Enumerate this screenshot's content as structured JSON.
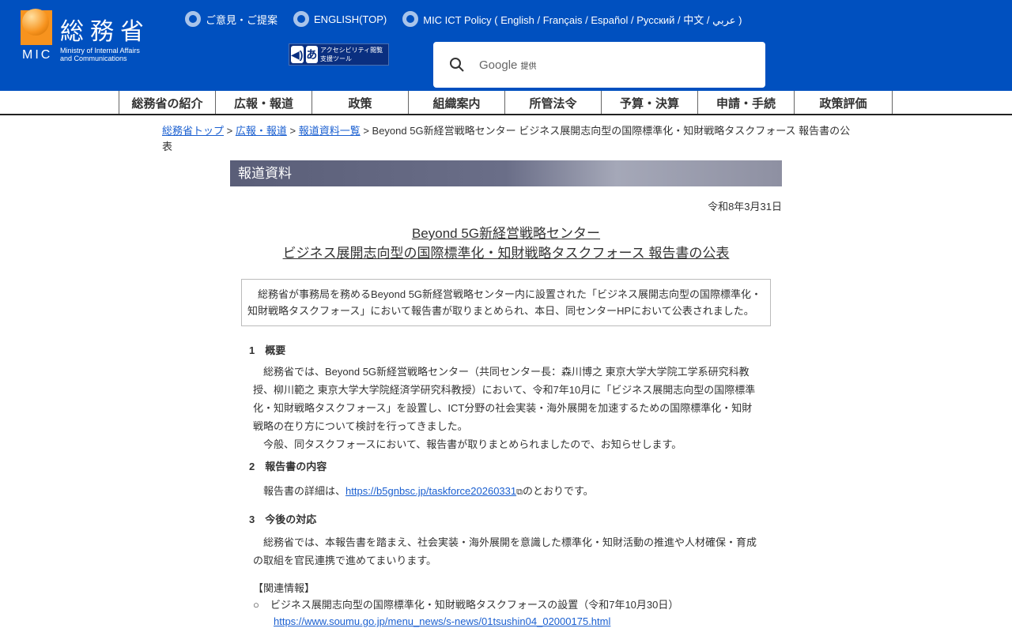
{
  "header": {
    "logo_jp": "総務省",
    "logo_mic": "MIC",
    "logo_en": [
      "Ministry of Internal Affairs",
      "and Communications"
    ],
    "links": [
      "ご意見・ご提案",
      "ENGLISH(TOP)",
      "MIC ICT Policy ( English / Français / Español / Русский / 中文 / عربي )"
    ],
    "a11y": "アクセシビリティ閲覧支援ツール",
    "search_brand": "Google",
    "search_provided": "提供"
  },
  "nav": [
    "総務省の紹介",
    "広報・報道",
    "政策",
    "組織案内",
    "所管法令",
    "予算・決算",
    "申請・手続",
    "政策評価"
  ],
  "breadcrumb": {
    "links": [
      "総務省トップ",
      "広報・報道",
      "報道資料一覧"
    ],
    "current": "Beyond 5G新経営戦略センター ビジネス展開志向型の国際標準化・知財戦略タスクフォース 報告書の公表"
  },
  "section_bar": "報道資料",
  "date": "令和8年3月31日",
  "title": [
    "Beyond 5G新経営戦略センター",
    "ビジネス展開志向型の国際標準化・知財戦略タスクフォース 報告書の公表"
  ],
  "summary": "総務省が事務局を務めるBeyond 5G新経営戦略センター内に設置された「ビジネス展開志向型の国際標準化・知財戦略タスクフォース」において報告書が取りまとめられ、本日、同センターHPにおいて公表されました。",
  "sections": [
    {
      "heading": "1　概要",
      "body": [
        "総務省では、Beyond 5G新経営戦略センター（共同センター長：森川博之 東京大学大学院工学系研究科教授、柳川範之 東京大学大学院経済学研究科教授）において、令和7年10月に「ビジネス展開志向型の国際標準化・知財戦略タスクフォース」を設置し、ICT分野の社会実装・海外展開を加速するための国際標準化・知財戦略の在り方について検討を行ってきました。",
        "今般、同タスクフォースにおいて、報告書が取りまとめられましたので、お知らせします。"
      ]
    },
    {
      "heading": "2　報告書の内容",
      "pre": "報告書の詳細は、",
      "link": "https://b5gnbsc.jp/taskforce20260331",
      "post": "のとおりです。"
    },
    {
      "heading": "3　今後の対応",
      "body": [
        "総務省では、本報告書を踏まえ、社会実装・海外展開を意識した標準化・知財活動の推進や人材確保・育成の取組を官民連携で進めてまいります。"
      ]
    }
  ],
  "related": {
    "heading": "【関連情報】",
    "items": [
      {
        "text": "ビジネス展開志向型の国際標準化・知財戦略タスクフォースの設置（令和7年10月30日）",
        "url": "https://www.soumu.go.jp/menu_news/s-news/01tsushin04_02000175.html"
      }
    ]
  }
}
